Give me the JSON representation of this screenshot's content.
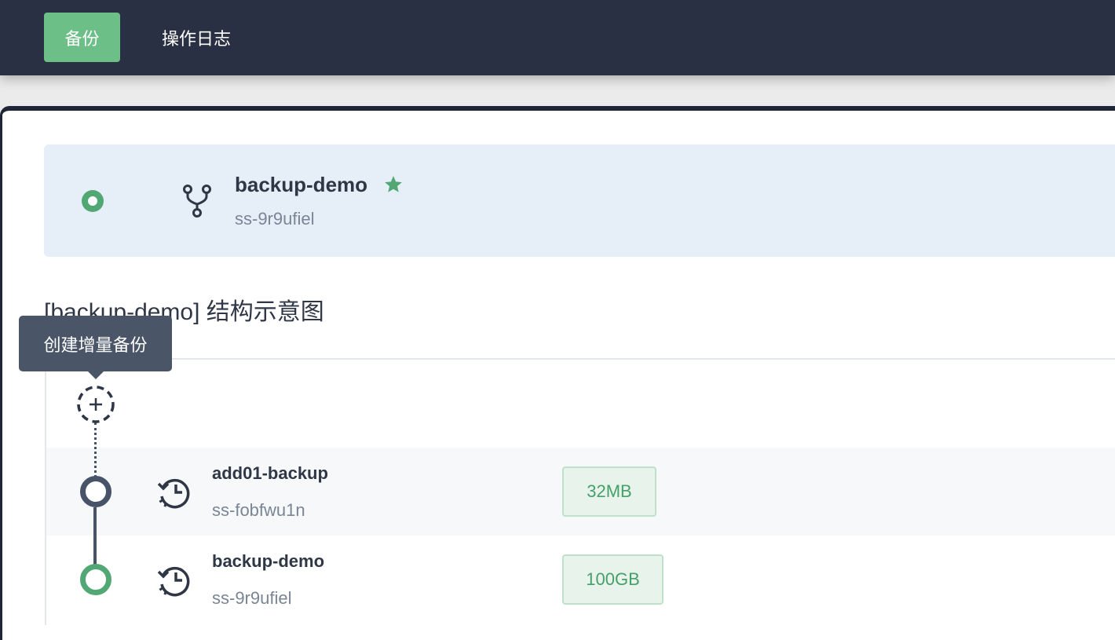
{
  "nav": {
    "tabs": [
      {
        "label": "备份",
        "active": true
      },
      {
        "label": "操作日志",
        "active": false
      }
    ]
  },
  "instance": {
    "name": "backup-demo",
    "id": "ss-9r9ufiel",
    "status_color": "#52a874",
    "icon": "branch-icon",
    "favorite_icon": "star-icon"
  },
  "structure": {
    "title": "[backup-demo] 结构示意图",
    "add_tooltip": "创建增量备份",
    "add_icon": "add-circle-icon",
    "nodes": [
      {
        "name": "add01-backup",
        "id": "ss-fobfwu1n",
        "size": "32MB",
        "icon": "history-icon",
        "node_color": "#475467"
      },
      {
        "name": "backup-demo",
        "id": "ss-9r9ufiel",
        "size": "100GB",
        "icon": "history-icon",
        "node_color": "#52a874"
      }
    ]
  },
  "colors": {
    "nav_bg": "#2a3044",
    "accent": "#6cbf86",
    "badge_text": "#46a06a"
  }
}
